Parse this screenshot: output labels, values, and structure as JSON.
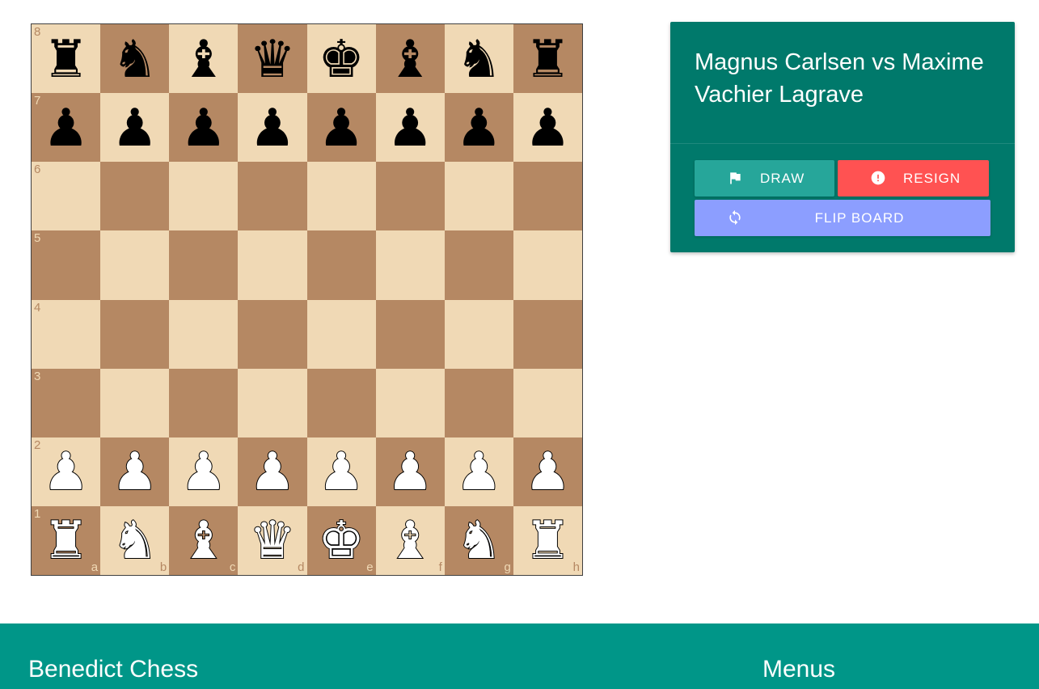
{
  "board": {
    "ranks": [
      "8",
      "7",
      "6",
      "5",
      "4",
      "3",
      "2",
      "1"
    ],
    "files": [
      "a",
      "b",
      "c",
      "d",
      "e",
      "f",
      "g",
      "h"
    ],
    "position": [
      [
        "br",
        "bn",
        "bb",
        "bq",
        "bk",
        "bb",
        "bn",
        "br"
      ],
      [
        "bp",
        "bp",
        "bp",
        "bp",
        "bp",
        "bp",
        "bp",
        "bp"
      ],
      [
        "",
        "",
        "",
        "",
        "",
        "",
        "",
        ""
      ],
      [
        "",
        "",
        "",
        "",
        "",
        "",
        "",
        ""
      ],
      [
        "",
        "",
        "",
        "",
        "",
        "",
        "",
        ""
      ],
      [
        "",
        "",
        "",
        "",
        "",
        "",
        "",
        ""
      ],
      [
        "wp",
        "wp",
        "wp",
        "wp",
        "wp",
        "wp",
        "wp",
        "wp"
      ],
      [
        "wr",
        "wn",
        "wb",
        "wq",
        "wk",
        "wb",
        "wn",
        "wr"
      ]
    ],
    "colors": {
      "light": "#f0d9b5",
      "dark": "#b58863"
    }
  },
  "game": {
    "title": "Magnus Carlsen vs Maxime Vachier Lagrave",
    "draw_label": "DRAW",
    "draw_icon": "flag-icon",
    "resign_label": "RESIGN",
    "resign_icon": "alert-icon",
    "flip_label": "FLIP BOARD",
    "flip_icon": "sync-icon"
  },
  "footer": {
    "brand": "Benedict Chess",
    "menus_heading": "Menus"
  },
  "colors": {
    "card": "#00796b",
    "footer": "#009688",
    "draw": "#26a69a",
    "resign": "#ff5252",
    "flip": "#8c9eff"
  }
}
